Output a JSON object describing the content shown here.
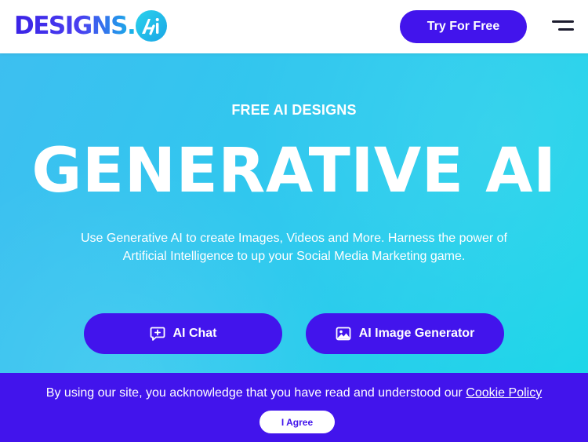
{
  "header": {
    "logo_text": "DESIGNS.",
    "logo_badge_text": "Ai",
    "try_button": "Try For Free",
    "menu_icon": "hamburger-menu-icon"
  },
  "hero": {
    "eyebrow": "FREE AI DESIGNS",
    "headline": "GENERATIVE AI",
    "subtext": "Use Generative AI to create Images, Videos and More. Harness the power of Artificial Intelligence to up your Social Media Marketing game.",
    "buttons": [
      {
        "label": "AI Chat",
        "icon": "chat-plus-icon"
      },
      {
        "label": "AI Image Generator",
        "icon": "image-icon"
      }
    ]
  },
  "cookie_banner": {
    "text": "By using our site, you acknowledge that you have read and understood our",
    "link": "Cookie Policy",
    "agree_button": "I Agree"
  },
  "colors": {
    "primary": "#4214ec",
    "hero_gradient_start": "#3dbff0",
    "hero_gradient_end": "#1bd8e8",
    "logo_badge": "#1aa6e6"
  }
}
